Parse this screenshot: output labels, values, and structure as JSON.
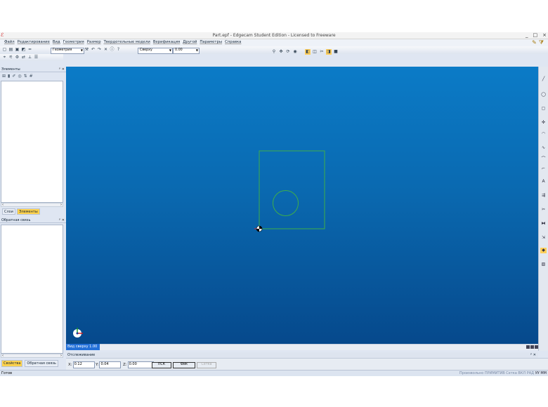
{
  "window": {
    "title": "Part.epf - Edgecam Student Edition - Licensed to Freeware",
    "controls": [
      "_",
      "□",
      "×"
    ]
  },
  "menu": {
    "items": [
      "Файл",
      "Редактирование",
      "Вид",
      "Геометрия",
      "Размер",
      "Твердотельные модели",
      "Верификация",
      "Другой",
      "Параметры",
      "Справка"
    ]
  },
  "toolbar": {
    "geometry_combo": "Геометрия",
    "view_combo": "Сверху",
    "value_combo": "0.00"
  },
  "panels": {
    "elements_title": "Элементы",
    "feedback_title": "Обратная связь",
    "tabs": [
      "Слои",
      "Элементы"
    ],
    "active_tab": "Элементы",
    "bottom_tabs": [
      "Свойства",
      "Обратная связь"
    ],
    "active_bottom_tab": "Свойства"
  },
  "viewport": {
    "label": "Вид сверху 1.00",
    "background_top": "#0b7bc7",
    "background_bottom": "#06498c",
    "geometry_color": "#3fae4a"
  },
  "tracking": {
    "title": "Отслеживание",
    "x_label": "X:",
    "x_value": "0.12",
    "y_label": "Y:",
    "y_value": "0.04",
    "z_label": "Z:",
    "z_value": "0.00",
    "btn_psk": "ПСК",
    "btn_fix": "Фик",
    "btn_snap": "Сетка"
  },
  "status": {
    "left": "Готов",
    "right_dim": "Произвольно ПРИМИТИВ Сетка ВКЛ РАД",
    "right_active": "УУ ММ"
  }
}
